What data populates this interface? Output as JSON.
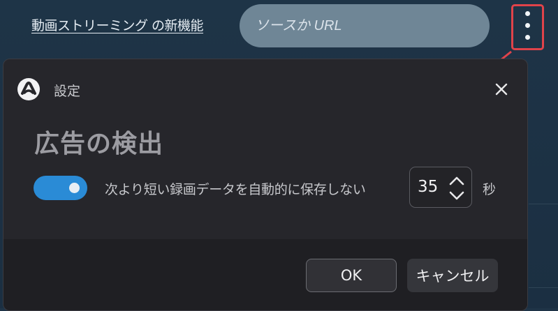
{
  "header": {
    "new_feature_link": "動画ストリーミング の新機能",
    "source_input_placeholder": "ソースか URL",
    "menu_icon": "kebab-menu-icon"
  },
  "dialog": {
    "title": "設定",
    "logo_icon": "app-logo-icon",
    "close_icon": "close-icon",
    "heading": "広告の検出",
    "toggle_on": true,
    "setting_label": "次より短い録画データを自動的に保存しない",
    "seconds_value": "35",
    "seconds_unit": "秒",
    "ok_label": "OK",
    "cancel_label": "キャンセル"
  },
  "colors": {
    "accent": "#2a8bd6",
    "highlight": "#e0434a",
    "dialog_bg": "#26262b"
  }
}
